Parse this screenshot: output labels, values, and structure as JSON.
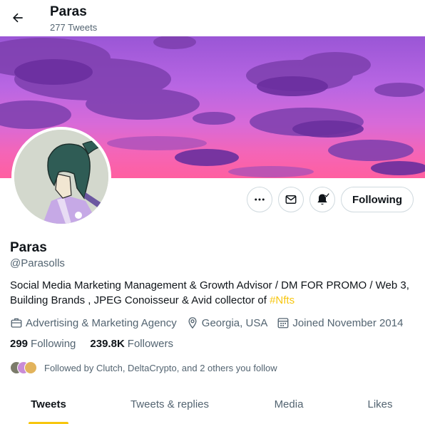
{
  "header": {
    "title": "Paras",
    "tweet_count": "277 Tweets"
  },
  "profile": {
    "name": "Paras",
    "handle": "@Parasolls",
    "bio_text": "Social Media Marketing Management & Growth Advisor / DM FOR PROMO / Web 3, Building Brands , JPEG Conoisseur & Avid collector of ",
    "bio_hashtag": "#Nfts",
    "category": "Advertising & Marketing Agency",
    "location": "Georgia, USA",
    "joined": "Joined November 2014",
    "following_count": "299",
    "following_label": "Following",
    "followers_count": "239.8K",
    "followers_label": "Followers",
    "followed_by": "Followed by Clutch, DeltaCrypto, and 2 others you follow"
  },
  "actions": {
    "following_button": "Following"
  },
  "tabs": [
    {
      "label": "Tweets",
      "active": true
    },
    {
      "label": "Tweets & replies",
      "active": false
    },
    {
      "label": "Media",
      "active": false
    },
    {
      "label": "Likes",
      "active": false
    }
  ],
  "colors": {
    "accent": "#f7c60f",
    "text_primary": "#0f1419",
    "text_secondary": "#536471",
    "border": "#cfd9de"
  },
  "icons": {
    "back": "arrow-left-icon",
    "more": "more-horizontal-icon",
    "message": "envelope-icon",
    "notify": "bell-check-icon",
    "category": "briefcase-icon",
    "location": "map-pin-icon",
    "joined": "calendar-icon"
  }
}
